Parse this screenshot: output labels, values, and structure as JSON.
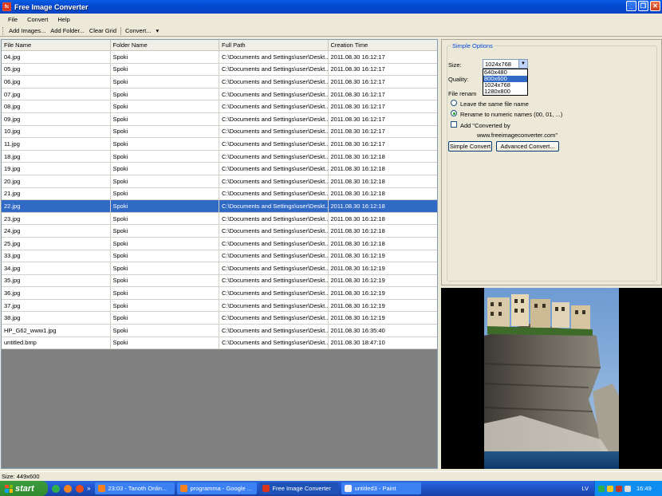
{
  "window": {
    "title": "Free Image Converter"
  },
  "menu": [
    "File",
    "Convert",
    "Help"
  ],
  "toolbar": {
    "add_images": "Add Images...",
    "add_folder": "Add Folder...",
    "clear_grid": "Clear Grid",
    "convert": "Convert...",
    "convert_arrow": "▾"
  },
  "grid": {
    "columns": [
      "File Name",
      "Folder Name",
      "Full Path",
      "Creation Time"
    ],
    "rows": [
      [
        "04.jpg",
        "Spoki",
        "C:\\Documents and Settings\\user\\Deskt...",
        "2011.08.30 16:12:17"
      ],
      [
        "05.jpg",
        "Spoki",
        "C:\\Documents and Settings\\user\\Deskt...",
        "2011.08.30 16:12:17"
      ],
      [
        "06.jpg",
        "Spoki",
        "C:\\Documents and Settings\\user\\Deskt...",
        "2011.08.30 16:12:17"
      ],
      [
        "07.jpg",
        "Spoki",
        "C:\\Documents and Settings\\user\\Deskt...",
        "2011.08.30 16:12:17"
      ],
      [
        "08.jpg",
        "Spoki",
        "C:\\Documents and Settings\\user\\Deskt...",
        "2011.08.30 16:12:17"
      ],
      [
        "09.jpg",
        "Spoki",
        "C:\\Documents and Settings\\user\\Deskt...",
        "2011.08.30 16:12:17"
      ],
      [
        "10.jpg",
        "Spoki",
        "C:\\Documents and Settings\\user\\Deskt...",
        "2011.08.30 16:12:17"
      ],
      [
        "11.jpg",
        "Spoki",
        "C:\\Documents and Settings\\user\\Deskt...",
        "2011.08.30 16:12:17"
      ],
      [
        "18.jpg",
        "Spoki",
        "C:\\Documents and Settings\\user\\Deskt...",
        "2011.08.30 16:12:18"
      ],
      [
        "19.jpg",
        "Spoki",
        "C:\\Documents and Settings\\user\\Deskt...",
        "2011.08.30 16:12:18"
      ],
      [
        "20.jpg",
        "Spoki",
        "C:\\Documents and Settings\\user\\Deskt...",
        "2011.08.30 16:12:18"
      ],
      [
        "21.jpg",
        "Spoki",
        "C:\\Documents and Settings\\user\\Deskt...",
        "2011.08.30 16:12:18"
      ],
      [
        "22.jpg",
        "Spoki",
        "C:\\Documents and Settings\\user\\Deskt...",
        "2011.08.30 16:12:18"
      ],
      [
        "23.jpg",
        "Spoki",
        "C:\\Documents and Settings\\user\\Deskt...",
        "2011.08.30 16:12:18"
      ],
      [
        "24.jpg",
        "Spoki",
        "C:\\Documents and Settings\\user\\Deskt...",
        "2011.08.30 16:12:18"
      ],
      [
        "25.jpg",
        "Spoki",
        "C:\\Documents and Settings\\user\\Deskt...",
        "2011.08.30 16:12:18"
      ],
      [
        "33.jpg",
        "Spoki",
        "C:\\Documents and Settings\\user\\Deskt...",
        "2011.08.30 16:12:19"
      ],
      [
        "34.jpg",
        "Spoki",
        "C:\\Documents and Settings\\user\\Deskt...",
        "2011.08.30 16:12:19"
      ],
      [
        "35.jpg",
        "Spoki",
        "C:\\Documents and Settings\\user\\Deskt...",
        "2011.08.30 16:12:19"
      ],
      [
        "36.jpg",
        "Spoki",
        "C:\\Documents and Settings\\user\\Deskt...",
        "2011.08.30 16:12:19"
      ],
      [
        "37.jpg",
        "Spoki",
        "C:\\Documents and Settings\\user\\Deskt...",
        "2011.08.30 16:12:19"
      ],
      [
        "38.jpg",
        "Spoki",
        "C:\\Documents and Settings\\user\\Deskt...",
        "2011.08.30 16:12:19"
      ],
      [
        "HP_G62_www1.jpg",
        "Spoki",
        "C:\\Documents and Settings\\user\\Deskt...",
        "2011.08.30 16:35:40"
      ],
      [
        "untitled.bmp",
        "Spoki",
        "C:\\Documents and Settings\\user\\Deskt...",
        "2011.08.30 18:47:10"
      ]
    ],
    "selected_row": 12
  },
  "options": {
    "group_title": "Simple Options",
    "size_label": "Size:",
    "size_value": "1024x768",
    "size_options": [
      "640x480",
      "800x600",
      "1024x768",
      "1280x800"
    ],
    "size_highlighted": "800x600",
    "quality_label": "Quality:",
    "file_rename_label": "File renam",
    "radio_same_name": "Leave the same file name",
    "radio_numeric": "Rename to numeric names (00, 01, ...)",
    "checkbox_label": "Add \"Converted by",
    "checkbox_label2": "www.freeimageconverter.com\"",
    "simple_convert": "Simple Convert",
    "advanced_convert": "Advanced Convert..."
  },
  "status": {
    "text": "Size: 449x600"
  },
  "taskbar": {
    "start": "start",
    "quick_launch_more": "»",
    "tasks": [
      "23:03 - Tanoth Onlin...",
      "programma - Google ...",
      "Free Image Converter",
      "untitled3 - Paint"
    ],
    "active_task": 2,
    "lang": "LV",
    "clock": "16:49"
  },
  "colors": {
    "selection": "#316ac5",
    "titlebar": "#0a5fe6",
    "taskbar": "#245edb",
    "start": "#3c9c3c"
  }
}
